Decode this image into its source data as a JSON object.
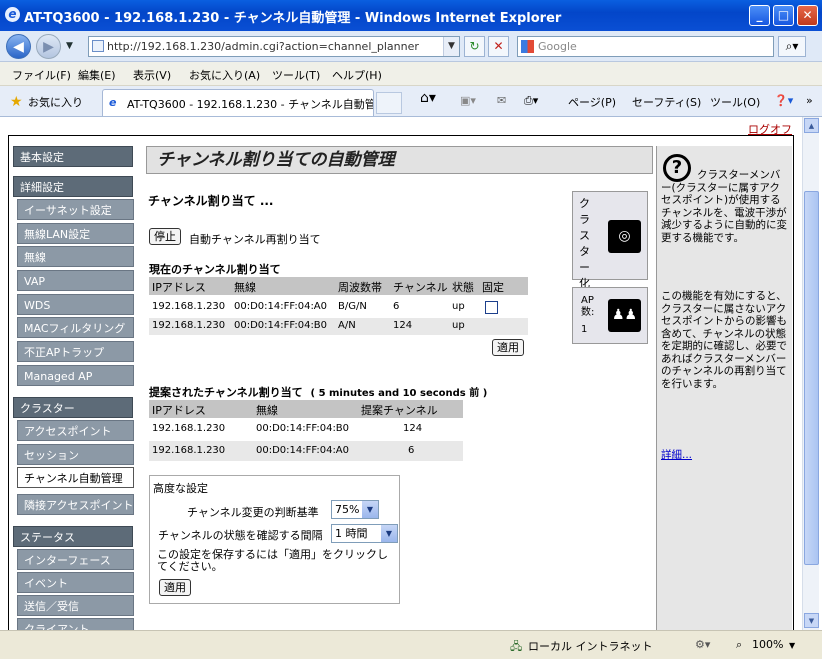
{
  "window": {
    "title": "AT-TQ3600 - 192.168.1.230 - チャンネル自動管理 - Windows Internet Explorer",
    "min": "_",
    "max": "□",
    "close": "✕"
  },
  "address": {
    "url": "http://192.168.1.230/admin.cgi?action=channel_planner",
    "search_placeholder": "Google"
  },
  "menu": [
    "ファイル(F)",
    "編集(E)",
    "表示(V)",
    "お気に入り(A)",
    "ツール(T)",
    "ヘルプ(H)"
  ],
  "favbar": {
    "favorites": "お気に入り",
    "tab_title": "AT-TQ3600 - 192.168.1.230 - チャンネル自動管...",
    "page": "ページ(P)",
    "safety": "セーフティ(S)",
    "tools": "ツール(O)"
  },
  "page": {
    "logout": "ログオフ",
    "heading": "チャンネル割り当ての自動管理"
  },
  "nav": [
    {
      "label": "基本設定",
      "type": "grp"
    },
    {
      "label": "詳細設定",
      "type": "grp"
    },
    {
      "label": "イーサネット設定",
      "type": "sub"
    },
    {
      "label": "無線LAN設定",
      "type": "sub"
    },
    {
      "label": "無線",
      "type": "sub"
    },
    {
      "label": "VAP",
      "type": "sub"
    },
    {
      "label": "WDS",
      "type": "sub"
    },
    {
      "label": "MACフィルタリング",
      "type": "sub"
    },
    {
      "label": "不正APトラップ",
      "type": "sub"
    },
    {
      "label": "Managed AP",
      "type": "sub"
    },
    {
      "label": "クラスター",
      "type": "grp"
    },
    {
      "label": "アクセスポイント",
      "type": "sub"
    },
    {
      "label": "セッション",
      "type": "sub"
    },
    {
      "label": "チャンネル自動管理",
      "type": "active"
    },
    {
      "label": "隣接アクセスポイント",
      "type": "sub"
    },
    {
      "label": "ステータス",
      "type": "grp"
    },
    {
      "label": "インターフェース",
      "type": "sub"
    },
    {
      "label": "イベント",
      "type": "sub"
    },
    {
      "label": "送信／受信",
      "type": "sub"
    },
    {
      "label": "クライアント",
      "type": "sub"
    }
  ],
  "main": {
    "assign_title": "チャンネル割り当て ...",
    "stop_button": "停止",
    "auto_reassign": "自動チャンネル再割り当て",
    "current_title": "現在のチャンネル割り当て",
    "current_headers": [
      "IPアドレス",
      "無線",
      "周波数帯",
      "チャンネル",
      "状態",
      "固定"
    ],
    "current_rows": [
      [
        "192.168.1.230",
        "00:D0:14:FF:04:A0",
        "B/G/N",
        "6",
        "up"
      ],
      [
        "192.168.1.230",
        "00:D0:14:FF:04:B0",
        "A/N",
        "124",
        "up"
      ]
    ],
    "apply_button": "適用",
    "proposed_title": "提案されたチャンネル割り当て",
    "proposed_time": "( 5 minutes and 10 seconds 前 )",
    "proposed_headers": [
      "IPアドレス",
      "無線",
      "提案チャンネル"
    ],
    "proposed_rows": [
      [
        "192.168.1.230",
        "00:D0:14:FF:04:B0",
        "124"
      ],
      [
        "192.168.1.230",
        "00:D0:14:FF:04:A0",
        "6"
      ]
    ],
    "advanced_title": "高度な設定",
    "threshold_label": "チャンネル変更の判断基準",
    "threshold_value": "75%",
    "interval_label": "チャンネルの状態を確認する間隔",
    "interval_value": "1 時間",
    "save_note": "この設定を保存するには「適用」をクリックしてください。",
    "apply_button2": "適用"
  },
  "cards": {
    "cluster_label": "クラスター化",
    "ap_count_label": "AP数:",
    "ap_count": "1"
  },
  "help": {
    "p1": "クラスターメンバー(クラスターに属すアクセスポイント)が使用するチャンネルを、電波干渉が減少するように自動的に変更する機能です。",
    "p2": "この機能を有効にすると、クラスターに属さないアクセスポイントからの影響も含めて、チャンネルの状態を定期的に確認し、必要であればクラスターメンバーのチャンネルの再割り当てを行います。",
    "more": "詳細..."
  },
  "status": {
    "zone": "ローカル イントラネット",
    "zoom": "100%"
  }
}
